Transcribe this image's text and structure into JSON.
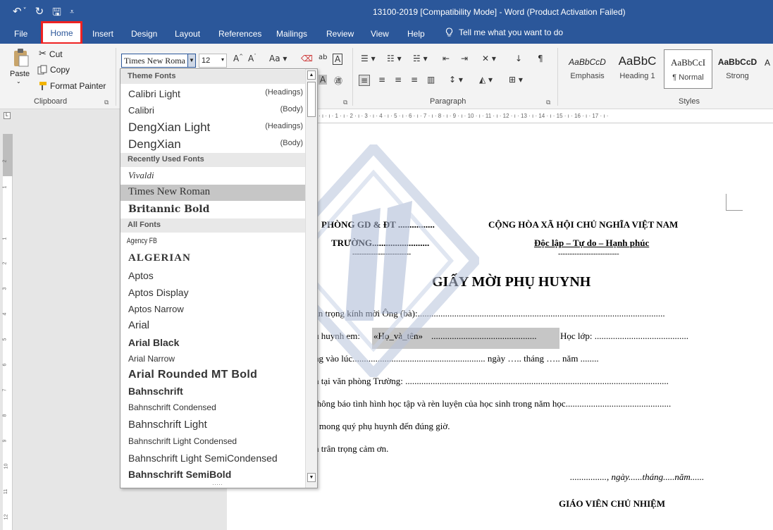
{
  "titlebar": {
    "title": "13100-2019 [Compatibility Mode]  -  Word (Product Activation Failed)",
    "qat": {
      "undo": "↶",
      "undo_dd": "˅",
      "redo": "↻",
      "save": "🖫",
      "customize": "⩡"
    }
  },
  "menu": {
    "tabs": [
      "File",
      "Home",
      "Insert",
      "Design",
      "Layout",
      "References",
      "Mailings",
      "Review",
      "View",
      "Help"
    ],
    "tell_me": "Tell me what you want to do",
    "active": "Home"
  },
  "ribbon": {
    "clipboard": {
      "paste": "Paste",
      "cut": "Cut",
      "copy": "Copy",
      "format_painter": "Format Painter",
      "label": "Clipboard"
    },
    "font": {
      "name": "Times New Roma",
      "size": "12"
    },
    "paragraph": {
      "label": "Paragraph"
    },
    "styles": {
      "label": "Styles",
      "items": [
        {
          "sample": "AaBbCcD",
          "name": "Emphasis"
        },
        {
          "sample": "AaBbC",
          "name": "Heading 1"
        },
        {
          "sample": "AaBbCcI",
          "name": "¶ Normal"
        },
        {
          "sample": "AaBbCcD",
          "name": "Strong"
        }
      ]
    }
  },
  "font_dropdown": {
    "sections": {
      "theme": "Theme Fonts",
      "recent": "Recently Used Fonts",
      "all": "All Fonts"
    },
    "theme_fonts": [
      {
        "name": "Calibri Light",
        "tag": "(Headings)"
      },
      {
        "name": "Calibri",
        "tag": "(Body)"
      },
      {
        "name": "DengXian Light",
        "tag": "(Headings)"
      },
      {
        "name": "DengXian",
        "tag": "(Body)"
      }
    ],
    "recent_fonts": [
      "Vivaldi",
      "Times New Roman",
      "Britannic Bold"
    ],
    "all_fonts": [
      "Agency FB",
      "ALGERIAN",
      "Aptos",
      "Aptos Display",
      "Aptos Narrow",
      "Arial",
      "Arial Black",
      "Arial Narrow",
      "Arial Rounded MT Bold",
      "Bahnschrift",
      "Bahnschrift Condensed",
      "Bahnschrift Light",
      "Bahnschrift Light Condensed",
      "Bahnschrift Light SemiCondensed",
      "Bahnschrift SemiBold"
    ],
    "selected": "Times New Roman"
  },
  "ruler": {
    "text": "· ı · ı · 1 · ı · 2 · ı · 3 · ı · 4 · ı · 5 · ı · 6 · ı · 7 · ı · 8 · ı · 9 · ı · 10 · ı · 11 · ı · 12 · ı · 13 · ı · 14 · ı · 15 · ı · 16 · ı · 17 · ı ·",
    "vertical": [
      "2",
      "1",
      "1",
      "2",
      "3",
      "4",
      "5",
      "6",
      "7",
      "8",
      "9",
      "10",
      "11",
      "12"
    ]
  },
  "document": {
    "org_left_1": "PHÒNG GD & ĐT ................",
    "org_left_2": "TRƯỜNG.........................",
    "org_left_dash": "-------------------------",
    "org_right_1": "CỘNG HÒA XÃ HỘI CHỦ NGHĨA VIỆT NAM",
    "org_right_2": "Độc lập – Tự do – Hạnh phúc",
    "org_right_dash": "--------------------------",
    "title": "GIẤY MỜI PHỤ HUYNH",
    "line1": "ân trọng kính mời Ông (bà):............................................................................................................",
    "line2_a": "u huynh em:",
    "line2_field": "«Họ_và_tên»",
    "line2_b": "..............................................",
    "line2_c": "Học lớp: .........................................",
    "line3": "ng vào lúc.......................................................... ngày ….. tháng ….. năm ........",
    "line4": "n tại văn phòng Trường: ...................................................................................................................",
    "line5": " thông báo tình hình học tập và rèn luyện của học sinh trong năm học..............................................",
    "line6": "t mong quý phụ huynh đến đúng giờ.",
    "line7": "n trân trọng cảm ơn.",
    "date_line": "................, ngày......tháng.....năm......",
    "signer": "GIÁO VIÊN CHỦ NHIỆM"
  }
}
